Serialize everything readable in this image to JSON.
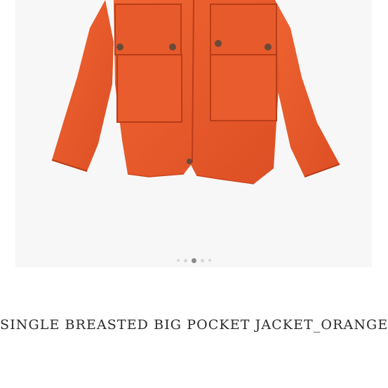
{
  "product": {
    "title": "SINGLE BREASTED BIG POCKET JACKET_ORANGE",
    "image_subject": "orange jacket",
    "jacket_color": "#e8552a"
  },
  "carousel": {
    "dot_count": 5,
    "active_index": 2
  }
}
